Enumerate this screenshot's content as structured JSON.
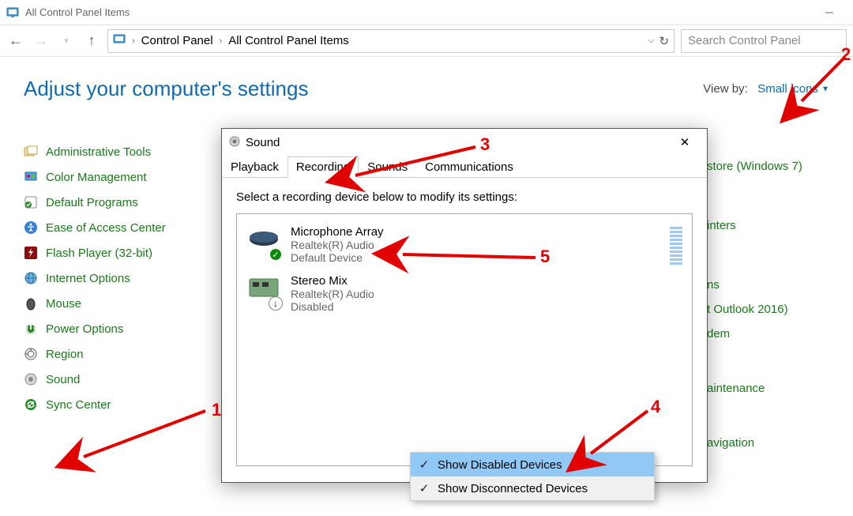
{
  "titlebar": {
    "title": "All Control Panel Items"
  },
  "nav": {
    "breadcrumbs": [
      "Control Panel",
      "All Control Panel Items"
    ],
    "search_placeholder": "Search Control Panel"
  },
  "header": {
    "title": "Adjust your computer's settings",
    "viewby_label": "View by:",
    "viewby_value": "Small icons"
  },
  "cp_items_left": [
    {
      "icon": "admin-tools-icon",
      "label": "Administrative Tools"
    },
    {
      "icon": "color-mgmt-icon",
      "label": "Color Management"
    },
    {
      "icon": "default-programs-icon",
      "label": "Default Programs"
    },
    {
      "icon": "ease-access-icon",
      "label": "Ease of Access Center"
    },
    {
      "icon": "flash-icon",
      "label": "Flash Player (32-bit)"
    },
    {
      "icon": "internet-options-icon",
      "label": "Internet Options"
    },
    {
      "icon": "mouse-icon",
      "label": "Mouse"
    },
    {
      "icon": "power-icon",
      "label": "Power Options"
    },
    {
      "icon": "region-icon",
      "label": "Region"
    },
    {
      "icon": "sound-icon",
      "label": "Sound"
    },
    {
      "icon": "sync-center-icon",
      "label": "Sync Center"
    }
  ],
  "cp_items_right": [
    {
      "label": "store (Windows 7)"
    },
    {
      "label": "inters"
    },
    {
      "label": "ns"
    },
    {
      "label": "t Outlook 2016)"
    },
    {
      "label": "dem"
    },
    {
      "label": "aintenance"
    },
    {
      "label": "avigation"
    }
  ],
  "sound_dlg": {
    "title": "Sound",
    "tabs": [
      "Playback",
      "Recording",
      "Sounds",
      "Communications"
    ],
    "active_tab": 1,
    "instruction": "Select a recording device below to modify its settings:",
    "devices": [
      {
        "name": "Microphone Array",
        "sub1": "Realtek(R) Audio",
        "sub2": "Default Device",
        "status": "default"
      },
      {
        "name": "Stereo Mix",
        "sub1": "Realtek(R) Audio",
        "sub2": "Disabled",
        "status": "disabled"
      }
    ],
    "ctx_menu": [
      {
        "label": "Show Disabled Devices",
        "checked": true,
        "hover": true
      },
      {
        "label": "Show Disconnected Devices",
        "checked": true,
        "hover": false
      }
    ]
  },
  "annotations": {
    "a1": "1",
    "a2": "2",
    "a3": "3",
    "a4": "4",
    "a5": "5"
  }
}
